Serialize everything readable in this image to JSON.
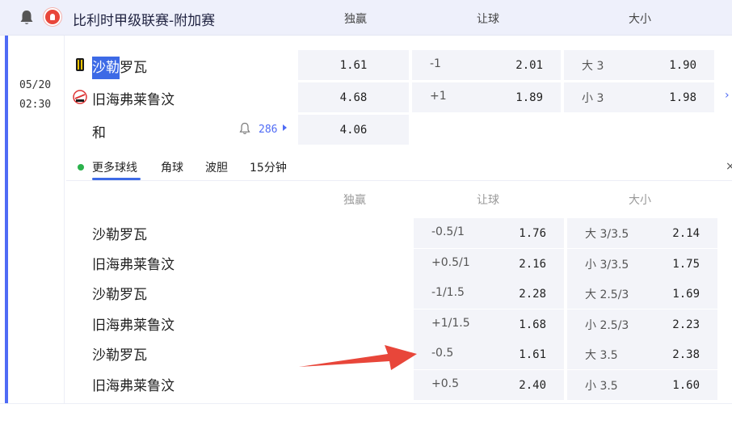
{
  "header": {
    "league": "比利时甲级联赛-附加赛",
    "col_1x2": "独赢",
    "col_handicap": "让球",
    "col_ou": "大小"
  },
  "match": {
    "date": "05/20",
    "time": "02:30",
    "home_prefix": "沙勒",
    "home_suffix": "罗瓦",
    "away": "旧海弗莱鲁汶",
    "draw": "和",
    "more_count": "286",
    "home_win": "1.61",
    "away_win": "4.68",
    "draw_odds": "4.06",
    "hcp_home_line": "-1",
    "hcp_home_odds": "2.01",
    "hcp_away_line": "+1",
    "hcp_away_odds": "1.89",
    "ou_over_line": "大 3",
    "ou_over_odds": "1.90",
    "ou_under_line": "小 3",
    "ou_under_odds": "1.98"
  },
  "tabs": [
    "更多球线",
    "角球",
    "波胆",
    "15分钟"
  ],
  "sub_header": {
    "col_1x2": "独赢",
    "col_handicap": "让球",
    "col_ou": "大小"
  },
  "lines": [
    {
      "team": "沙勒罗瓦",
      "hcp": "-0.5/1",
      "hcp_odds": "1.76",
      "ou": "大 3/3.5",
      "ou_odds": "2.14"
    },
    {
      "team": "旧海弗莱鲁汶",
      "hcp": "+0.5/1",
      "hcp_odds": "2.16",
      "ou": "小 3/3.5",
      "ou_odds": "1.75"
    },
    {
      "team": "沙勒罗瓦",
      "hcp": "-1/1.5",
      "hcp_odds": "2.28",
      "ou": "大 2.5/3",
      "ou_odds": "1.69"
    },
    {
      "team": "旧海弗莱鲁汶",
      "hcp": "+1/1.5",
      "hcp_odds": "1.68",
      "ou": "小 2.5/3",
      "ou_odds": "2.23"
    },
    {
      "team": "沙勒罗瓦",
      "hcp": "-0.5",
      "hcp_odds": "1.61",
      "ou": "大 3.5",
      "ou_odds": "2.38"
    },
    {
      "team": "旧海弗莱鲁汶",
      "hcp": "+0.5",
      "hcp_odds": "2.40",
      "ou": "小 3.5",
      "ou_odds": "1.60"
    }
  ],
  "icons": {
    "bell": "bell-icon",
    "notify": "bell-outline-icon",
    "caret": "caret-right-icon",
    "chevron": "chevron-right-icon",
    "close": "close-icon",
    "arrow": "red-arrow-annotation"
  },
  "colors": {
    "accent": "#4f6bf5",
    "selection": "#3d6ae6",
    "live_dot": "#2bb24c",
    "arrow": "#e8463a"
  }
}
